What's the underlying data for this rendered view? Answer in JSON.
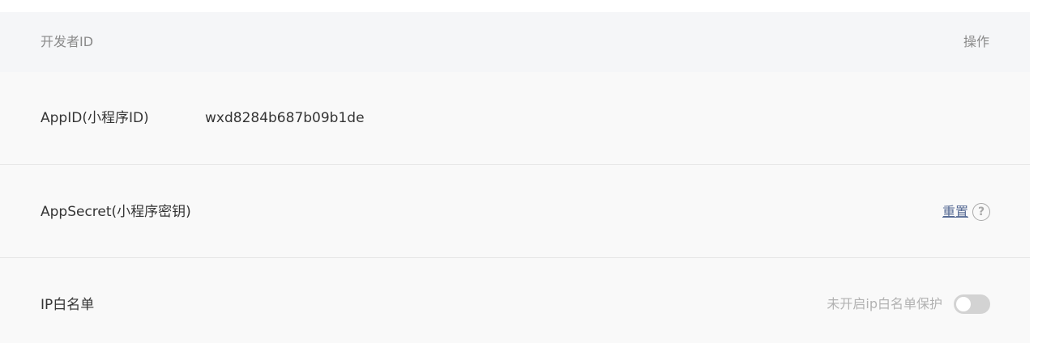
{
  "table": {
    "header": {
      "title": "开发者ID",
      "action_label": "操作"
    },
    "rows": [
      {
        "label": "AppID(小程序ID)",
        "value": "wxd8284b687b09b1de"
      },
      {
        "label": "AppSecret(小程序密钥)",
        "action_label": "重置",
        "help_icon": "question-circle-icon",
        "help_glyph": "?"
      },
      {
        "label": "IP白名单",
        "status_text": "未开启ip白名单保护",
        "toggle_on": false
      }
    ]
  },
  "colors": {
    "link": "#576b95",
    "toggle_off": "#d3d3d3",
    "header_bg": "#f5f6f8",
    "row_bg": "#f9f9f9"
  }
}
